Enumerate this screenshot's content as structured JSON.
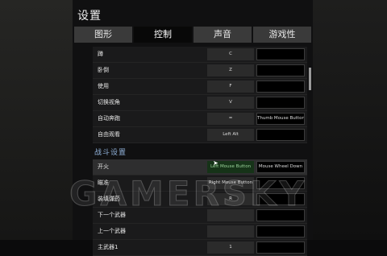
{
  "window": {
    "title": "设置"
  },
  "tabs": [
    {
      "label": "图形",
      "active": false
    },
    {
      "label": "控制",
      "active": true
    },
    {
      "label": "声音",
      "active": false
    },
    {
      "label": "游戏性",
      "active": false
    }
  ],
  "rows_top": [
    {
      "label": "蹲",
      "key1": "C",
      "key2": ""
    },
    {
      "label": "卧倒",
      "key1": "Z",
      "key2": ""
    },
    {
      "label": "使用",
      "key1": "F",
      "key2": ""
    },
    {
      "label": "切换视角",
      "key1": "V",
      "key2": ""
    },
    {
      "label": "自动奔跑",
      "key1": "=",
      "key2": "Thumb Mouse Button"
    },
    {
      "label": "自由观看",
      "key1": "Left Alt",
      "key2": ""
    }
  ],
  "section": {
    "label": "战斗设置"
  },
  "rows_combat": [
    {
      "label": "开火",
      "key1": "Left Mouse Button",
      "key2": "Mouse Wheel Down"
    },
    {
      "label": "瞄准",
      "key1": "Right Mouse Button",
      "key2": ""
    },
    {
      "label": "装填弹药",
      "key1": "R",
      "key2": ""
    },
    {
      "label": "下一个武器",
      "key1": "",
      "key2": ""
    },
    {
      "label": "上一个武器",
      "key1": "",
      "key2": ""
    },
    {
      "label": "主武器1",
      "key1": "1",
      "key2": ""
    }
  ],
  "watermark": "GAMERSKY",
  "colors": {
    "section_accent": "#8fb0d8",
    "highlight_key": "#163318"
  }
}
